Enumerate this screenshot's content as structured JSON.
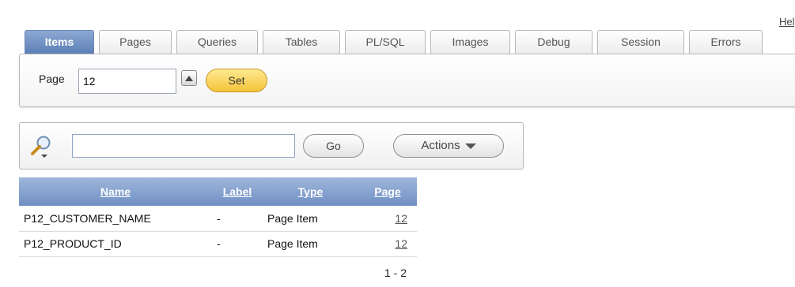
{
  "help": {
    "label": "Help"
  },
  "tabs": [
    {
      "label": "Items",
      "active": true
    },
    {
      "label": "Pages",
      "active": false
    },
    {
      "label": "Queries",
      "active": false
    },
    {
      "label": "Tables",
      "active": false
    },
    {
      "label": "PL/SQL",
      "active": false
    },
    {
      "label": "Images",
      "active": false
    },
    {
      "label": "Debug",
      "active": false
    },
    {
      "label": "Session",
      "active": false
    },
    {
      "label": "Errors",
      "active": false
    }
  ],
  "page_panel": {
    "label": "Page",
    "value": "12",
    "set_label": "Set"
  },
  "search": {
    "value": "",
    "go_label": "Go",
    "actions_label": "Actions"
  },
  "table": {
    "headers": {
      "name": "Name",
      "label": "Label",
      "type": "Type",
      "page": "Page"
    },
    "rows": [
      {
        "name": "P12_CUSTOMER_NAME",
        "label": "-",
        "type": "Page Item",
        "page": "12"
      },
      {
        "name": "P12_PRODUCT_ID",
        "label": "-",
        "type": "Page Item",
        "page": "12"
      }
    ],
    "pagination": "1 - 2"
  },
  "colors": {
    "active_tab": "#6f8fc3",
    "set_button": "#f5c43a",
    "header": "#7f9ccb"
  },
  "icons": [
    "search-icon",
    "chevron-up-icon",
    "caret-down-icon"
  ]
}
